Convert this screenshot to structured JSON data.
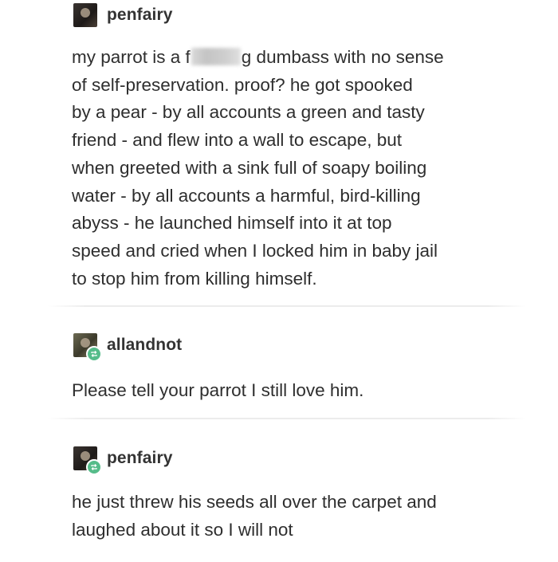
{
  "posts": [
    {
      "username": "penfairy",
      "body_before": "my parrot is a f",
      "body_after": "g dumbass with no sense\nof self-preservation. proof? he got spooked\nby a pear - by all accounts a green and tasty\nfriend - and flew into a wall to escape, but\nwhen greeted with a sink full of soapy boiling\nwater - by all accounts a harmful, bird-killing\nabyss - he launched himself into it at top\nspeed and cried when I locked him in baby jail\nto stop him from killing himself."
    },
    {
      "username": "allandnot",
      "body": "Please tell your parrot I still love him."
    },
    {
      "username": "penfairy",
      "body": "he just threw his seeds all over the carpet and\nlaughed about it so I will not"
    }
  ]
}
